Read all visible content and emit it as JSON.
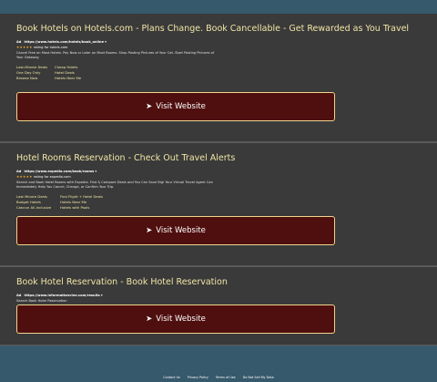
{
  "ads": [
    {
      "title": "Book Hotels on Hotels.com - Plans Change. Book Cancellable - Get Rewarded as You Travel",
      "badge": "Ad",
      "url": "https://www.hotels.com/hotels/book_online",
      "url_arrow": "▾",
      "stars": "★★★★★",
      "rating_text": "rating for hotels.com",
      "description": "Cancel Free on Most Hotels. Pay Now or Later on Most Rooms. Shop Posting Pictures of Your Cat. Start Posting Pictures of Your Getaway.",
      "sitelinks": [
        "Last-Minute Deals",
        "Cheap Hotels",
        "One Day Only",
        "Hotel Deals",
        "Browse Now",
        "Hotels Near Me"
      ],
      "button_label": "Visit Website"
    },
    {
      "title": "Hotel Rooms Reservation - Check Out Travel Alerts",
      "badge": "Ad",
      "url": "https://www.expedia.com/book/rooms",
      "url_arrow": "▾",
      "stars": "★★★★★",
      "rating_text": "rating for expedia.com",
      "description": "Search and Book Hotel Rooms with Expedia. Find & Compare Deals and You Can Save Big! Your Virtual Travel Agent Can Immediately Help You Cancel, Change, or Confirm Your Trip.",
      "sitelinks": [
        "Last Minute Deals",
        "Find Flight + Hotel Deals",
        "Budget Hotels",
        "Hotels Near Me",
        "Cancun All-Inclusive",
        "Hotels with Pools"
      ],
      "button_label": "Visit Website"
    },
    {
      "title": "Book Hotel Reservation - Book Hotel Reservation",
      "badge": "Ad",
      "url": "https://www.informationvine.com/results",
      "url_arrow": "▾",
      "description": "Search Book Hotel Reservation",
      "button_label": "Visit Website"
    }
  ],
  "button_icon": "➤",
  "footer": [
    "Contact Us",
    "Privacy Policy",
    "Terms of Use",
    "Do Not Sell My Data"
  ],
  "colors": {
    "page_bg": "#36596b",
    "card_bg": "#3a3a3a",
    "title": "#f1e6a6",
    "button_bg": "#4f0f0f",
    "button_border": "#efd58b",
    "stars": "#f2a93b"
  }
}
